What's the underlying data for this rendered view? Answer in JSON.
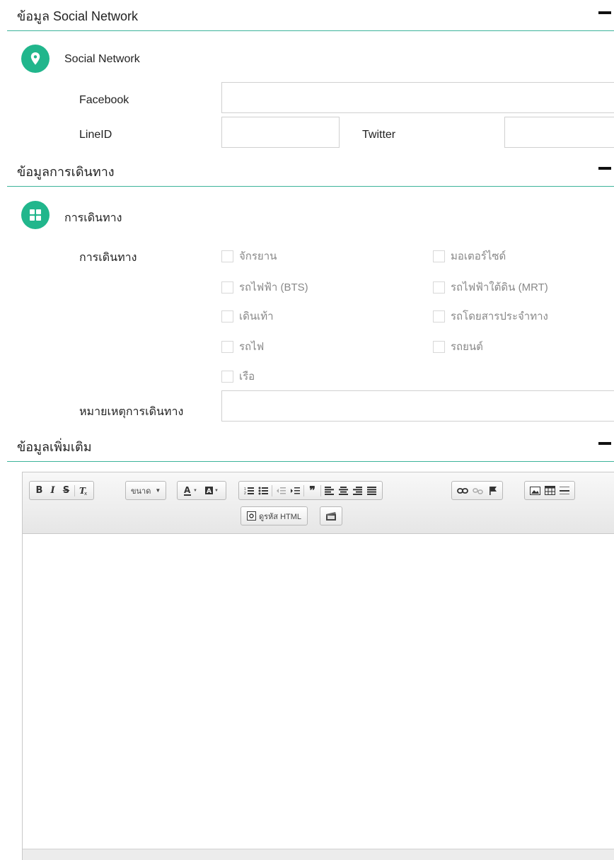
{
  "sections": {
    "social": {
      "title": "ข้อมูล Social Network",
      "collapse_icon": "minus-icon"
    },
    "travel": {
      "title": "ข้อมูลการเดินทาง",
      "collapse_icon": "minus-icon"
    },
    "additional": {
      "title": "ข้อมูลเพิ่มเติม",
      "collapse_icon": "minus-icon"
    }
  },
  "social": {
    "subtitle": "Social Network",
    "icon": "map-pin-icon",
    "facebook": {
      "label": "Facebook",
      "value": ""
    },
    "lineid": {
      "label": "LineID",
      "value": ""
    },
    "twitter": {
      "label": "Twitter",
      "value": ""
    }
  },
  "travel": {
    "subtitle": "การเดินทาง",
    "icon": "grid-icon",
    "options_label": "การเดินทาง",
    "options": [
      "จักรยาน",
      "มอเตอร์ไซด์",
      "รถไฟฟ้า (BTS)",
      "รถไฟฟ้าใต้ดิน (MRT)",
      "เดินเท้า",
      "รถโดยสารประจำทาง",
      "รถไฟ",
      "รถยนต์",
      "เรือ"
    ],
    "note": {
      "label": "หมายเหตุการเดินทาง",
      "value": ""
    }
  },
  "editor": {
    "toolbar": {
      "size_label": "ขนาด",
      "source_label": "ดูรหัส HTML"
    },
    "content": ""
  },
  "colors": {
    "accent": "#21b68c",
    "divider": "#3cb39a"
  }
}
